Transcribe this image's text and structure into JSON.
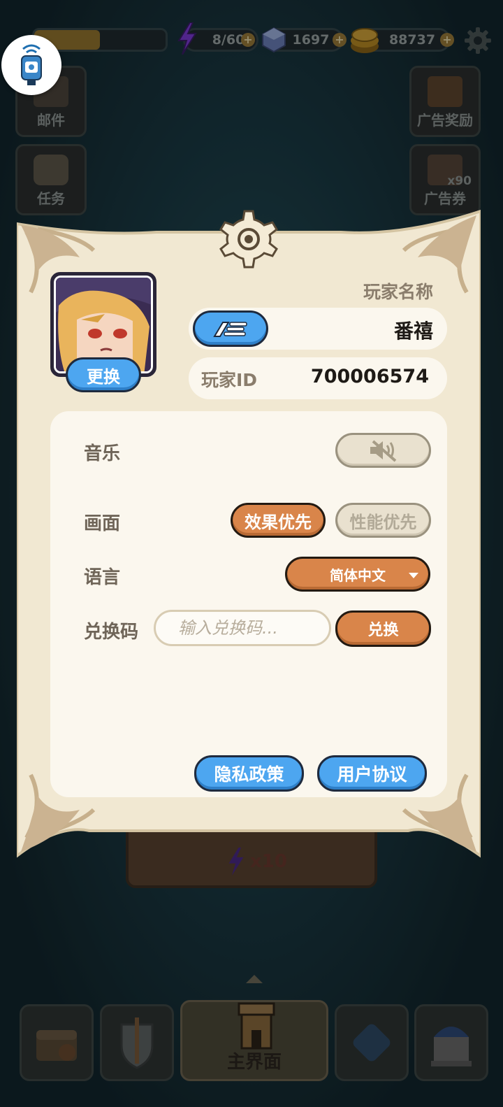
{
  "top_bar": {
    "energy": "8/60",
    "gems": "1697",
    "coins": "88737",
    "xp_progress": 0.5
  },
  "side_buttons": {
    "mail": "邮件",
    "tasks": "任务",
    "ad_reward": "广告奖励",
    "ad_ticket": "广告券",
    "ad_ticket_count": "x90"
  },
  "behind_card": {
    "cost": "x10"
  },
  "bottom_nav": {
    "main": "主界面"
  },
  "profile": {
    "name_label": "玩家名称",
    "name_value": "番禧",
    "change_avatar": "更换",
    "id_label": "玩家ID",
    "id_value": "700006574"
  },
  "settings": {
    "music_label": "音乐",
    "graphics_label": "画面",
    "graphics_quality": "效果优先",
    "graphics_performance": "性能优先",
    "language_label": "语言",
    "language_value": "简体中文",
    "redeem_label": "兑换码",
    "redeem_placeholder": "输入兑换码...",
    "redeem_button": "兑换",
    "privacy_policy": "隐私政策",
    "user_agreement": "用户协议"
  },
  "colors": {
    "panel": "#f1e8d2",
    "accent_orange": "#d9854a",
    "accent_blue": "#4da6f0"
  }
}
